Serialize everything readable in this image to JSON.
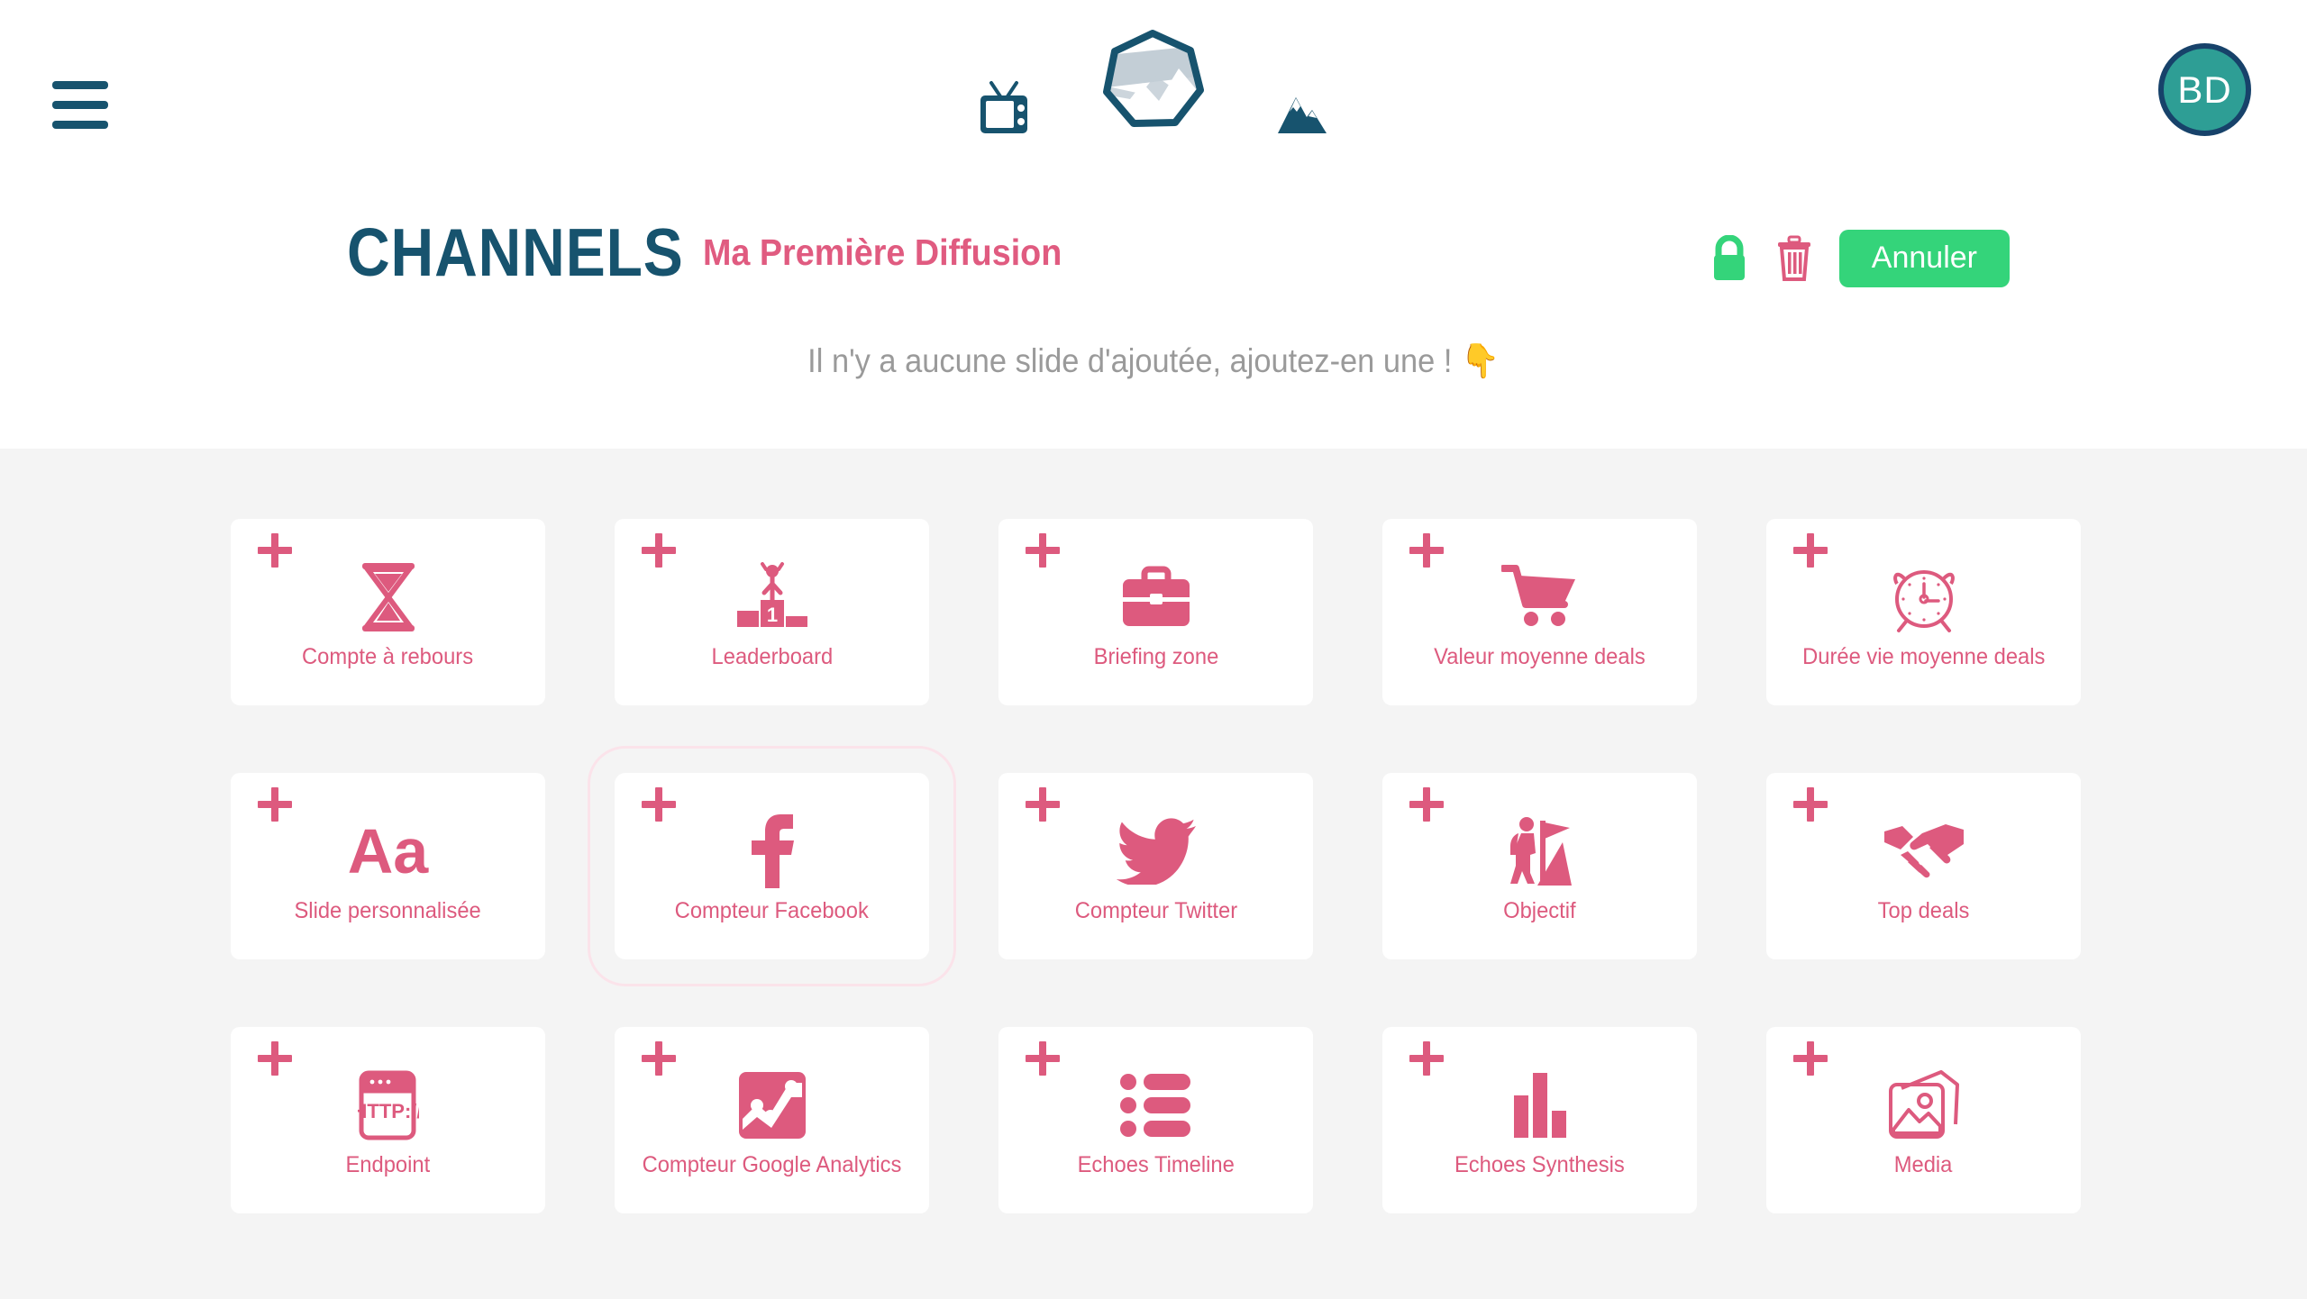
{
  "header": {
    "menu_icon": "hamburger-icon",
    "brand_icons": [
      "tv-icon",
      "logo-heptagon-mountain-icon",
      "mountain-icon"
    ],
    "avatar_initials": "BD",
    "title": "CHANNELS",
    "subtitle": "Ma Première Diffusion",
    "empty_message": "Il n'y a aucune slide d'ajoutée, ajoutez-en une ! 👇",
    "actions": {
      "lock_icon": "lock-icon",
      "trash_icon": "trash-icon",
      "cancel_label": "Annuler"
    }
  },
  "colors": {
    "pink": "#dd5a7e",
    "pink_title": "#e05b80",
    "teal_dark": "#17536e",
    "navy": "#17426a",
    "teal_avatar": "#2e9e95",
    "green": "#34d47a",
    "gray_bg": "#f4f4f4",
    "muted_text": "#9a9a9a",
    "highlight_outline": "#fbe3ea"
  },
  "grid": {
    "add_icon": "plus-icon",
    "cards": [
      {
        "label": "Compte à rebours",
        "icon": "hourglass-icon",
        "highlighted": false
      },
      {
        "label": "Leaderboard",
        "icon": "podium-icon",
        "highlighted": false
      },
      {
        "label": "Briefing zone",
        "icon": "briefcase-icon",
        "highlighted": false
      },
      {
        "label": "Valeur moyenne deals",
        "icon": "shopping-cart-icon",
        "highlighted": false
      },
      {
        "label": "Durée vie moyenne deals",
        "icon": "alarm-clock-icon",
        "highlighted": false
      },
      {
        "label": "Slide personnalisée",
        "icon": "text-aa-icon",
        "highlighted": false
      },
      {
        "label": "Compteur Facebook",
        "icon": "facebook-icon",
        "highlighted": true
      },
      {
        "label": "Compteur Twitter",
        "icon": "twitter-bird-icon",
        "highlighted": false
      },
      {
        "label": "Objectif",
        "icon": "flag-climber-icon",
        "highlighted": false
      },
      {
        "label": "Top deals",
        "icon": "handshake-icon",
        "highlighted": false
      },
      {
        "label": "Endpoint",
        "icon": "http-browser-icon",
        "highlighted": false
      },
      {
        "label": "Compteur Google Analytics",
        "icon": "line-chart-icon",
        "highlighted": false
      },
      {
        "label": "Echoes Timeline",
        "icon": "bullet-list-icon",
        "highlighted": false
      },
      {
        "label": "Echoes Synthesis",
        "icon": "bar-chart-icon",
        "highlighted": false
      },
      {
        "label": "Media",
        "icon": "photos-icon",
        "highlighted": false
      }
    ]
  }
}
